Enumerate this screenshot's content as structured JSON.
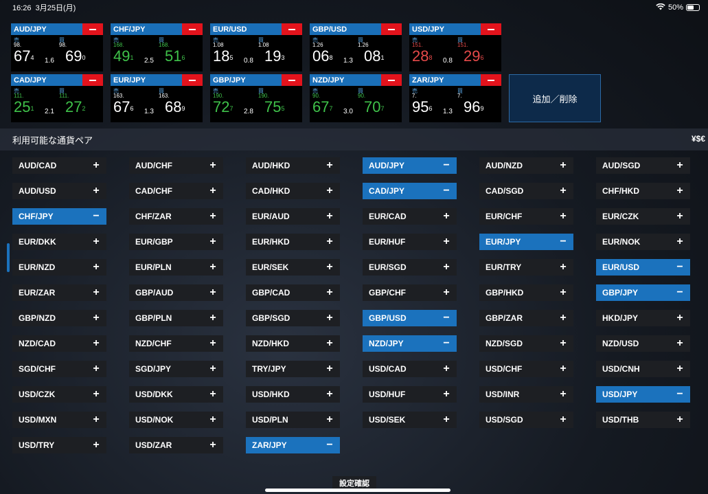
{
  "status": {
    "time": "16:26",
    "date": "3月25日(月)",
    "battery": "50%"
  },
  "tiles": [
    {
      "name": "AUD/JPY",
      "color": "white",
      "sell_label": "売",
      "buy_label": "買",
      "sell_big": "98.",
      "sell_main": "67",
      "sell_sup": "4",
      "buy_big": "98.",
      "buy_main": "69",
      "buy_sup": "0",
      "spread": "1.6"
    },
    {
      "name": "CHF/JPY",
      "color": "green",
      "sell_label": "売",
      "buy_label": "買",
      "sell_big": "168.",
      "sell_main": "49",
      "sell_sup": "1",
      "buy_big": "168.",
      "buy_main": "51",
      "buy_sup": "6",
      "spread": "2.5"
    },
    {
      "name": "EUR/USD",
      "color": "white",
      "sell_label": "売",
      "buy_label": "買",
      "sell_big": "1.08",
      "sell_main": "18",
      "sell_sup": "5",
      "buy_big": "1.08",
      "buy_main": "19",
      "buy_sup": "3",
      "spread": "0.8"
    },
    {
      "name": "GBP/USD",
      "color": "white",
      "sell_label": "売",
      "buy_label": "買",
      "sell_big": "1.26",
      "sell_main": "06",
      "sell_sup": "8",
      "buy_big": "1.26",
      "buy_main": "08",
      "buy_sup": "1",
      "spread": "1.3"
    },
    {
      "name": "USD/JPY",
      "color": "red",
      "sell_label": "売",
      "buy_label": "買",
      "sell_big": "151.",
      "sell_main": "28",
      "sell_sup": "8",
      "buy_big": "151.",
      "buy_main": "29",
      "buy_sup": "6",
      "spread": "0.8"
    },
    {
      "name": "CAD/JPY",
      "color": "green",
      "sell_label": "売",
      "buy_label": "買",
      "sell_big": "111.",
      "sell_main": "25",
      "sell_sup": "1",
      "buy_big": "111.",
      "buy_main": "27",
      "buy_sup": "2",
      "spread": "2.1"
    },
    {
      "name": "EUR/JPY",
      "color": "white",
      "sell_label": "売",
      "buy_label": "買",
      "sell_big": "163.",
      "sell_main": "67",
      "sell_sup": "6",
      "buy_big": "163.",
      "buy_main": "68",
      "buy_sup": "9",
      "spread": "1.3"
    },
    {
      "name": "GBP/JPY",
      "color": "green",
      "sell_label": "売",
      "buy_label": "買",
      "sell_big": "190.",
      "sell_main": "72",
      "sell_sup": "7",
      "buy_big": "190.",
      "buy_main": "75",
      "buy_sup": "5",
      "spread": "2.8"
    },
    {
      "name": "NZD/JPY",
      "color": "green",
      "sell_label": "売",
      "buy_label": "買",
      "sell_big": "90.",
      "sell_main": "67",
      "sell_sup": "7",
      "buy_big": "90.",
      "buy_main": "70",
      "buy_sup": "7",
      "spread": "3.0"
    },
    {
      "name": "ZAR/JPY",
      "color": "white",
      "sell_label": "売",
      "buy_label": "買",
      "sell_big": "7.",
      "sell_main": "95",
      "sell_sup": "6",
      "buy_big": "7.",
      "buy_main": "96",
      "buy_sup": "9",
      "spread": "1.3"
    }
  ],
  "add_remove_label": "追加／削除",
  "available_title": "利用可能な通貨ペア",
  "currency_glyph": "¥$€",
  "pairs": [
    {
      "name": "AUD/CAD",
      "selected": false
    },
    {
      "name": "AUD/CHF",
      "selected": false
    },
    {
      "name": "AUD/HKD",
      "selected": false
    },
    {
      "name": "AUD/JPY",
      "selected": true
    },
    {
      "name": "AUD/NZD",
      "selected": false
    },
    {
      "name": "AUD/SGD",
      "selected": false
    },
    {
      "name": "AUD/USD",
      "selected": false
    },
    {
      "name": "CAD/CHF",
      "selected": false
    },
    {
      "name": "CAD/HKD",
      "selected": false
    },
    {
      "name": "CAD/JPY",
      "selected": true
    },
    {
      "name": "CAD/SGD",
      "selected": false
    },
    {
      "name": "CHF/HKD",
      "selected": false
    },
    {
      "name": "CHF/JPY",
      "selected": true
    },
    {
      "name": "CHF/ZAR",
      "selected": false
    },
    {
      "name": "EUR/AUD",
      "selected": false
    },
    {
      "name": "EUR/CAD",
      "selected": false
    },
    {
      "name": "EUR/CHF",
      "selected": false
    },
    {
      "name": "EUR/CZK",
      "selected": false
    },
    {
      "name": "EUR/DKK",
      "selected": false
    },
    {
      "name": "EUR/GBP",
      "selected": false
    },
    {
      "name": "EUR/HKD",
      "selected": false
    },
    {
      "name": "EUR/HUF",
      "selected": false
    },
    {
      "name": "EUR/JPY",
      "selected": true
    },
    {
      "name": "EUR/NOK",
      "selected": false
    },
    {
      "name": "EUR/NZD",
      "selected": false
    },
    {
      "name": "EUR/PLN",
      "selected": false
    },
    {
      "name": "EUR/SEK",
      "selected": false
    },
    {
      "name": "EUR/SGD",
      "selected": false
    },
    {
      "name": "EUR/TRY",
      "selected": false
    },
    {
      "name": "EUR/USD",
      "selected": true
    },
    {
      "name": "EUR/ZAR",
      "selected": false
    },
    {
      "name": "GBP/AUD",
      "selected": false
    },
    {
      "name": "GBP/CAD",
      "selected": false
    },
    {
      "name": "GBP/CHF",
      "selected": false
    },
    {
      "name": "GBP/HKD",
      "selected": false
    },
    {
      "name": "GBP/JPY",
      "selected": true
    },
    {
      "name": "GBP/NZD",
      "selected": false
    },
    {
      "name": "GBP/PLN",
      "selected": false
    },
    {
      "name": "GBP/SGD",
      "selected": false
    },
    {
      "name": "GBP/USD",
      "selected": true
    },
    {
      "name": "GBP/ZAR",
      "selected": false
    },
    {
      "name": "HKD/JPY",
      "selected": false
    },
    {
      "name": "NZD/CAD",
      "selected": false
    },
    {
      "name": "NZD/CHF",
      "selected": false
    },
    {
      "name": "NZD/HKD",
      "selected": false
    },
    {
      "name": "NZD/JPY",
      "selected": true
    },
    {
      "name": "NZD/SGD",
      "selected": false
    },
    {
      "name": "NZD/USD",
      "selected": false
    },
    {
      "name": "SGD/CHF",
      "selected": false
    },
    {
      "name": "SGD/JPY",
      "selected": false
    },
    {
      "name": "TRY/JPY",
      "selected": false
    },
    {
      "name": "USD/CAD",
      "selected": false
    },
    {
      "name": "USD/CHF",
      "selected": false
    },
    {
      "name": "USD/CNH",
      "selected": false
    },
    {
      "name": "USD/CZK",
      "selected": false
    },
    {
      "name": "USD/DKK",
      "selected": false
    },
    {
      "name": "USD/HKD",
      "selected": false
    },
    {
      "name": "USD/HUF",
      "selected": false
    },
    {
      "name": "USD/INR",
      "selected": false
    },
    {
      "name": "USD/JPY",
      "selected": true
    },
    {
      "name": "USD/MXN",
      "selected": false
    },
    {
      "name": "USD/NOK",
      "selected": false
    },
    {
      "name": "USD/PLN",
      "selected": false
    },
    {
      "name": "USD/SEK",
      "selected": false
    },
    {
      "name": "USD/SGD",
      "selected": false
    },
    {
      "name": "USD/THB",
      "selected": false
    },
    {
      "name": "USD/TRY",
      "selected": false
    },
    {
      "name": "USD/ZAR",
      "selected": false
    },
    {
      "name": "ZAR/JPY",
      "selected": true
    }
  ],
  "confirm_label": "設定確認"
}
